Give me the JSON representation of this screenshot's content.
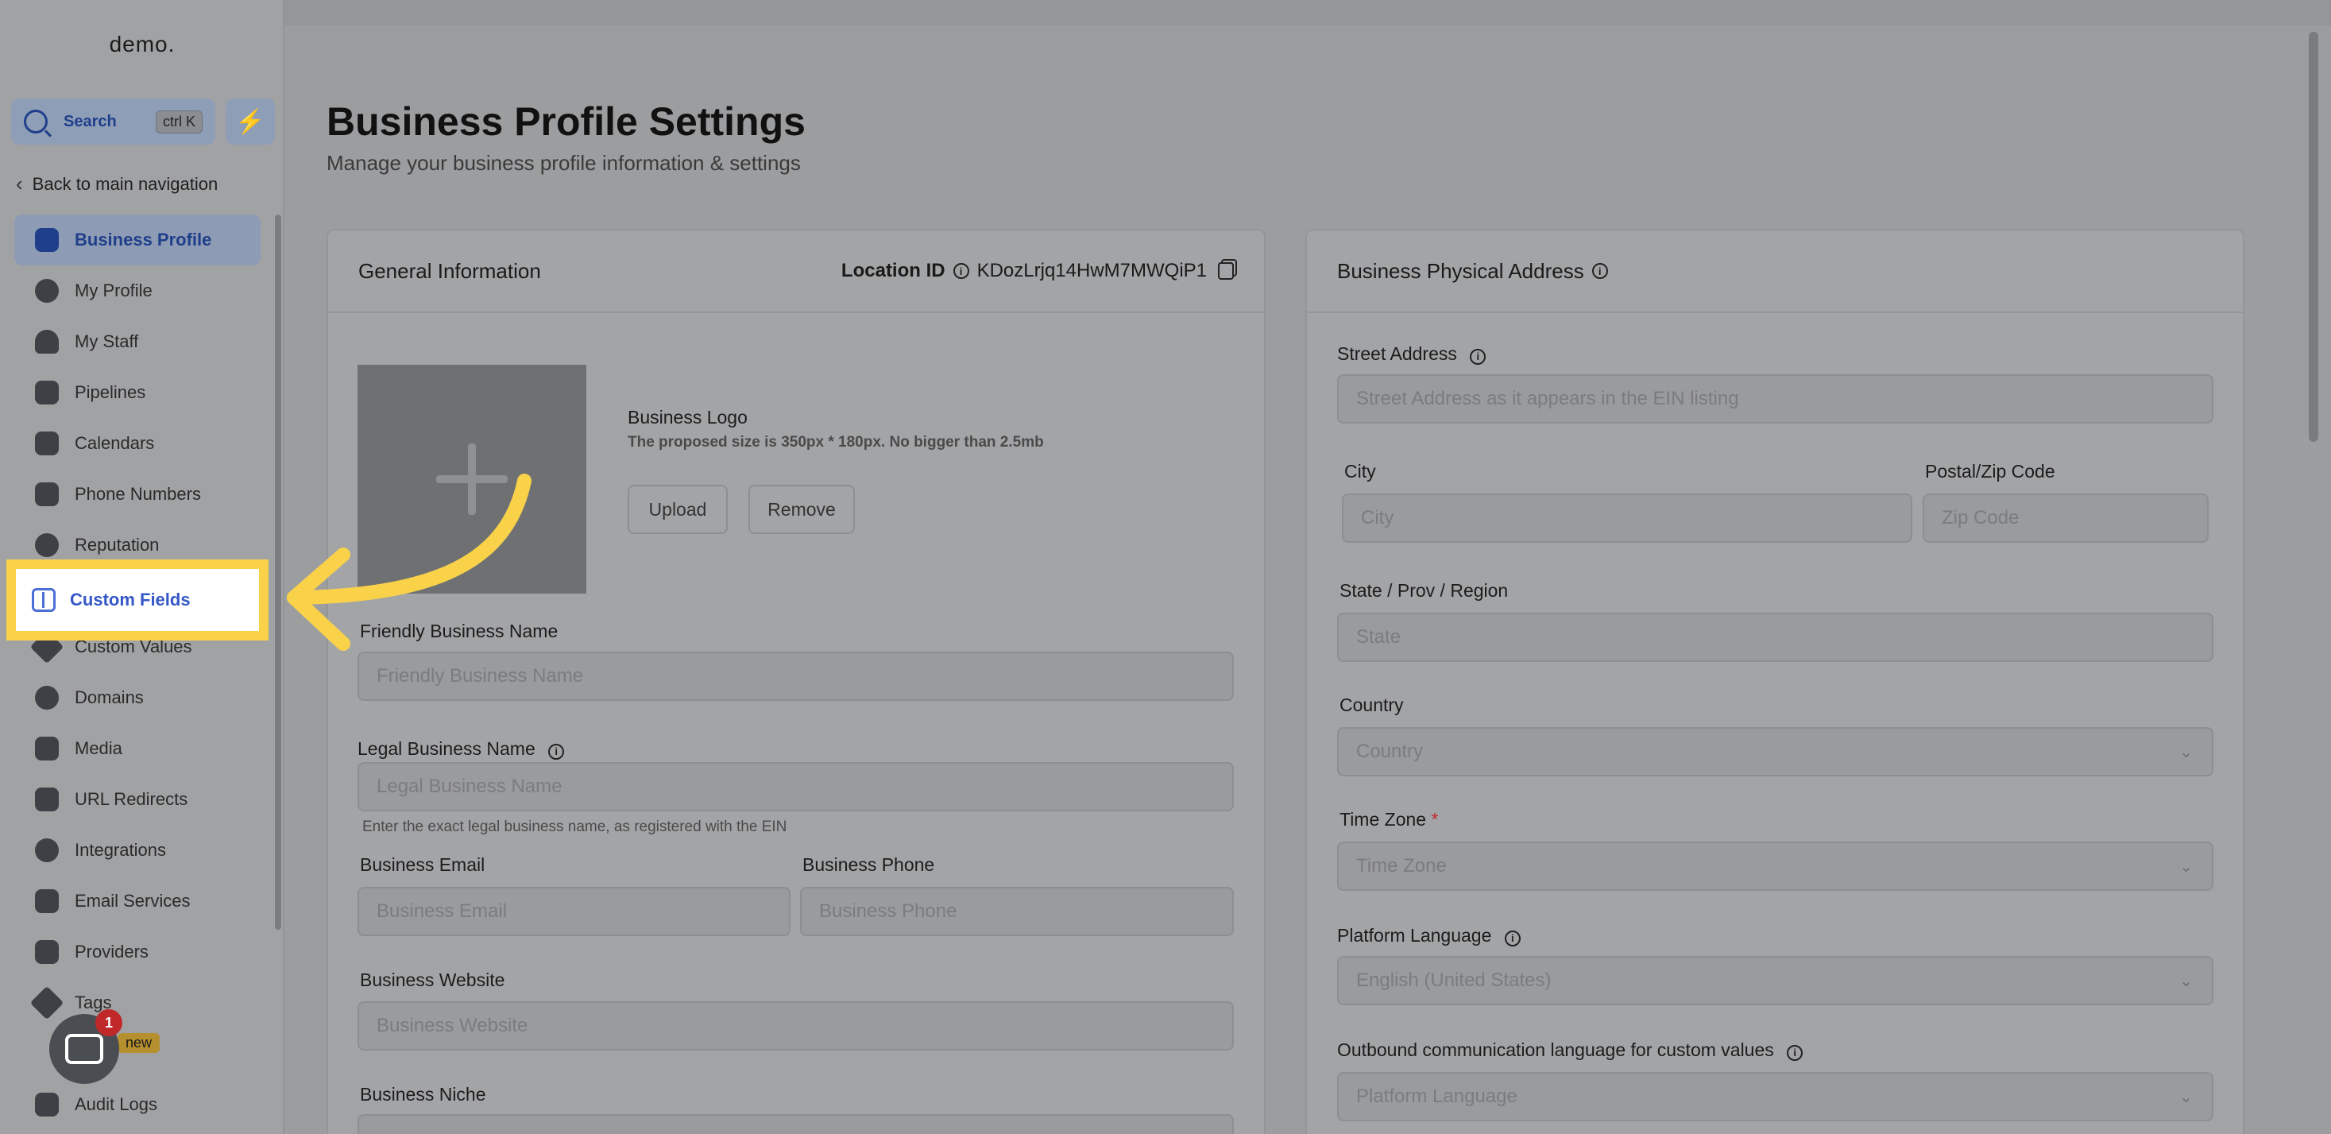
{
  "sidebar": {
    "logo": "demo.",
    "search": {
      "label": "Search",
      "shortcut": "ctrl K"
    },
    "quick_action_icon": "bolt-icon",
    "back_label": "Back to main navigation",
    "items": [
      {
        "label": "Business Profile",
        "icon": "briefcase-icon",
        "active": true
      },
      {
        "label": "My Profile",
        "icon": "user-circle-icon"
      },
      {
        "label": "My Staff",
        "icon": "user-icon"
      },
      {
        "label": "Pipelines",
        "icon": "funnel-icon"
      },
      {
        "label": "Calendars",
        "icon": "calendar-icon"
      },
      {
        "label": "Phone Numbers",
        "icon": "phone-icon"
      },
      {
        "label": "Reputation",
        "icon": "star-icon"
      },
      {
        "label": "Custom Fields",
        "icon": "custom-fields-icon",
        "highlighted": true
      },
      {
        "label": "Custom Values",
        "icon": "tag-icon"
      },
      {
        "label": "Domains",
        "icon": "globe-icon"
      },
      {
        "label": "Media",
        "icon": "media-icon"
      },
      {
        "label": "URL Redirects",
        "icon": "redirect-icon"
      },
      {
        "label": "Integrations",
        "icon": "integrations-icon"
      },
      {
        "label": "Email Services",
        "icon": "mail-icon"
      },
      {
        "label": "Providers",
        "icon": "providers-icon"
      },
      {
        "label": "Tags",
        "icon": "tag-icon"
      },
      {
        "label": "Audit Logs",
        "icon": "chart-icon"
      }
    ],
    "chat_badge_count": "1",
    "new_badge": "new"
  },
  "page": {
    "title": "Business Profile Settings",
    "subtitle": "Manage your business profile information & settings"
  },
  "general": {
    "title": "General Information",
    "location_label": "Location ID",
    "location_id": "KDozLrjq14HwM7MWQiP1",
    "logo_title": "Business Logo",
    "logo_hint": "The proposed size is 350px * 180px. No bigger than 2.5mb",
    "upload_label": "Upload",
    "remove_label": "Remove",
    "friendly_name_label": "Friendly Business Name",
    "friendly_name_placeholder": "Friendly Business Name",
    "legal_name_label": "Legal Business Name",
    "legal_name_placeholder": "Legal Business Name",
    "legal_name_hint": "Enter the exact legal business name, as registered with the EIN",
    "email_label": "Business Email",
    "email_placeholder": "Business Email",
    "phone_label": "Business Phone",
    "phone_placeholder": "Business Phone",
    "website_label": "Business Website",
    "website_placeholder": "Business Website",
    "niche_label": "Business Niche"
  },
  "address": {
    "title": "Business Physical Address",
    "street_label": "Street Address",
    "street_placeholder": "Street Address as it appears in the EIN listing",
    "city_label": "City",
    "city_placeholder": "City",
    "zip_label": "Postal/Zip Code",
    "zip_placeholder": "Zip Code",
    "state_label": "State / Prov / Region",
    "state_placeholder": "State",
    "country_label": "Country",
    "country_placeholder": "Country",
    "timezone_label": "Time Zone",
    "timezone_required": "*",
    "timezone_placeholder": "Time Zone",
    "platform_lang_label": "Platform Language",
    "platform_lang_value": "English (United States)",
    "outbound_lang_label": "Outbound communication language for custom values",
    "outbound_lang_placeholder": "Platform Language"
  },
  "colors": {
    "highlight": "#f9d24a",
    "accent": "#3558c8",
    "badge_red": "#c0282a"
  }
}
